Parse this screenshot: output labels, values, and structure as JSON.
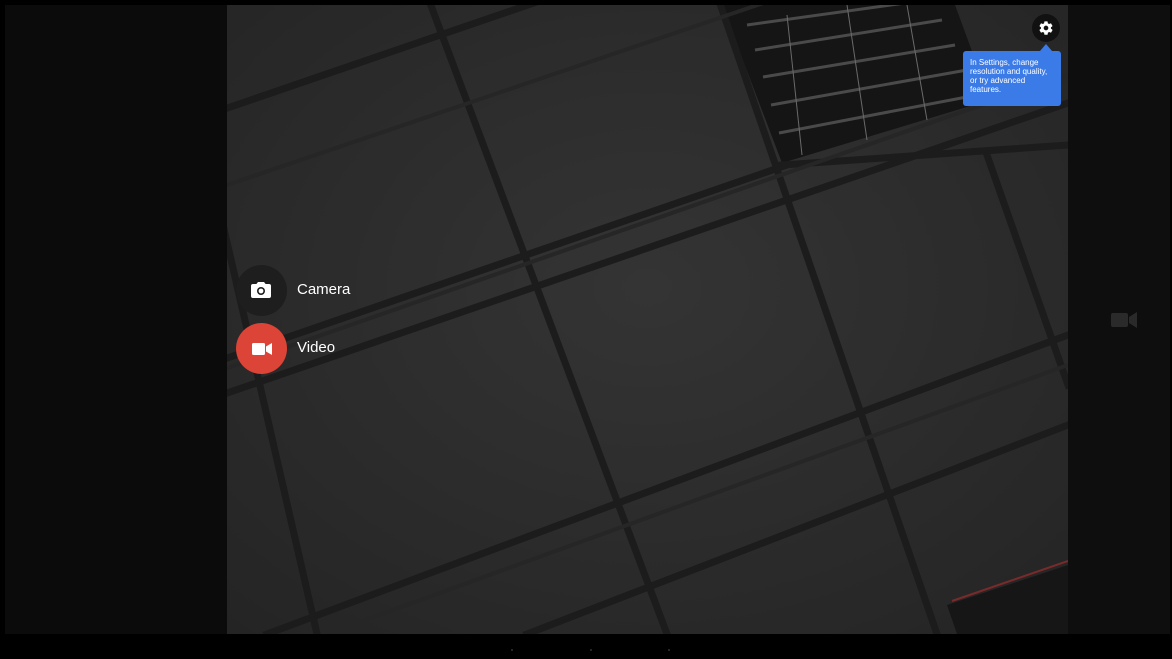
{
  "colors": {
    "tooltip_background": "#3b7be8",
    "video_accent": "#db4437",
    "camera_circle": "#1e1e1e"
  },
  "settings": {
    "icon": "gear-icon",
    "tooltip_text": "In Settings, change resolution and quality, or try advanced features."
  },
  "modes": {
    "camera": {
      "label": "Camera",
      "icon": "camera-icon"
    },
    "video": {
      "label": "Video",
      "icon": "video-camera-icon",
      "selected": true
    }
  },
  "side_control": {
    "icon": "video-camera-icon"
  }
}
